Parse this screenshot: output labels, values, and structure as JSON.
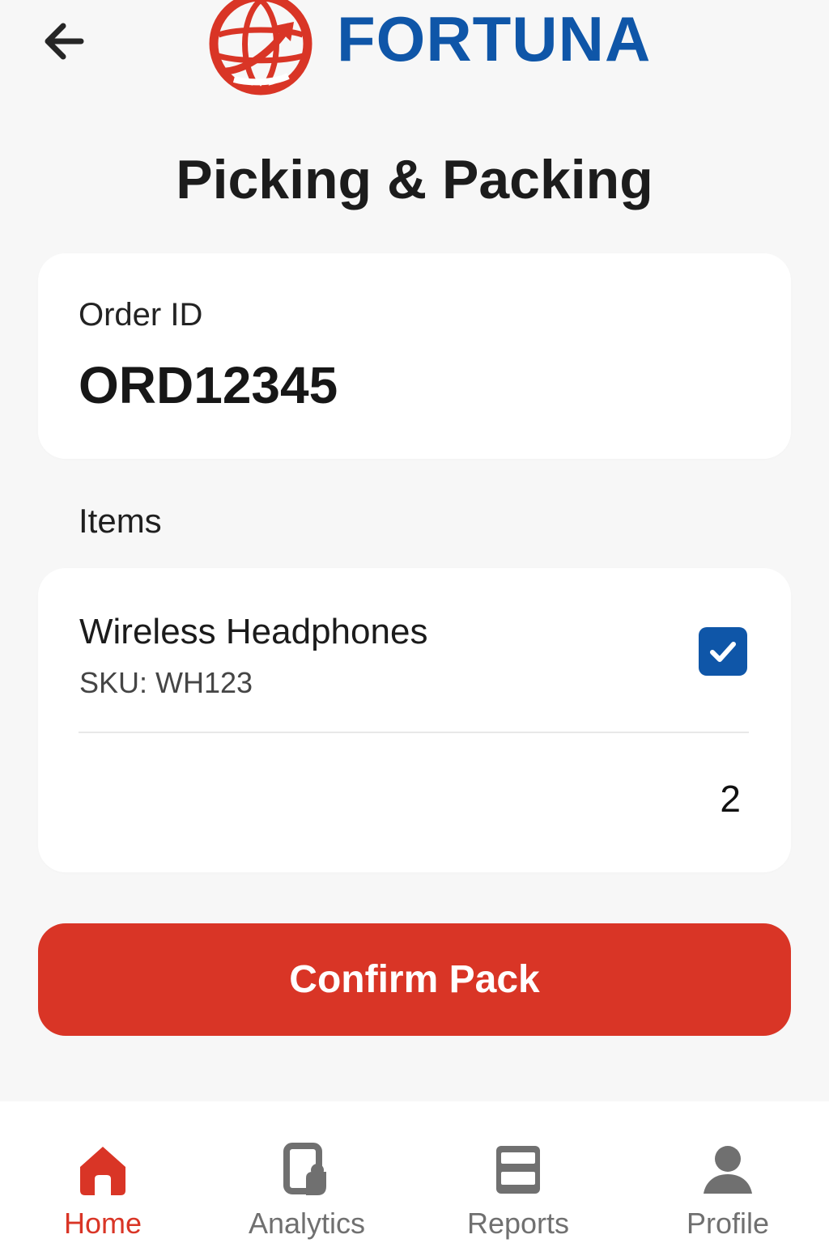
{
  "header": {
    "brand_name": "FORTUNA"
  },
  "page": {
    "title": "Picking & Packing"
  },
  "order": {
    "label": "Order ID",
    "value": "ORD12345"
  },
  "items": {
    "heading": "Items",
    "list": [
      {
        "name": "Wireless Headphones",
        "sku": "SKU: WH123",
        "quantity": "2",
        "checked": true
      }
    ]
  },
  "actions": {
    "confirm_label": "Confirm Pack"
  },
  "bottom_nav": [
    {
      "label": "Home",
      "icon": "home-icon",
      "active": true
    },
    {
      "label": "Analytics",
      "icon": "analytics-icon",
      "active": false
    },
    {
      "label": "Reports",
      "icon": "reports-icon",
      "active": false
    },
    {
      "label": "Profile",
      "icon": "profile-icon",
      "active": false
    }
  ],
  "colors": {
    "brand_blue": "#0f56a8",
    "accent_red": "#d93526",
    "background": "#f7f7f7",
    "card_background": "#ffffff",
    "muted_gray": "#707070"
  },
  "icons": {
    "back": "arrow-left-icon",
    "logo": "globe-arrow-logo-icon",
    "checkbox": "checkbox-checked-icon"
  }
}
